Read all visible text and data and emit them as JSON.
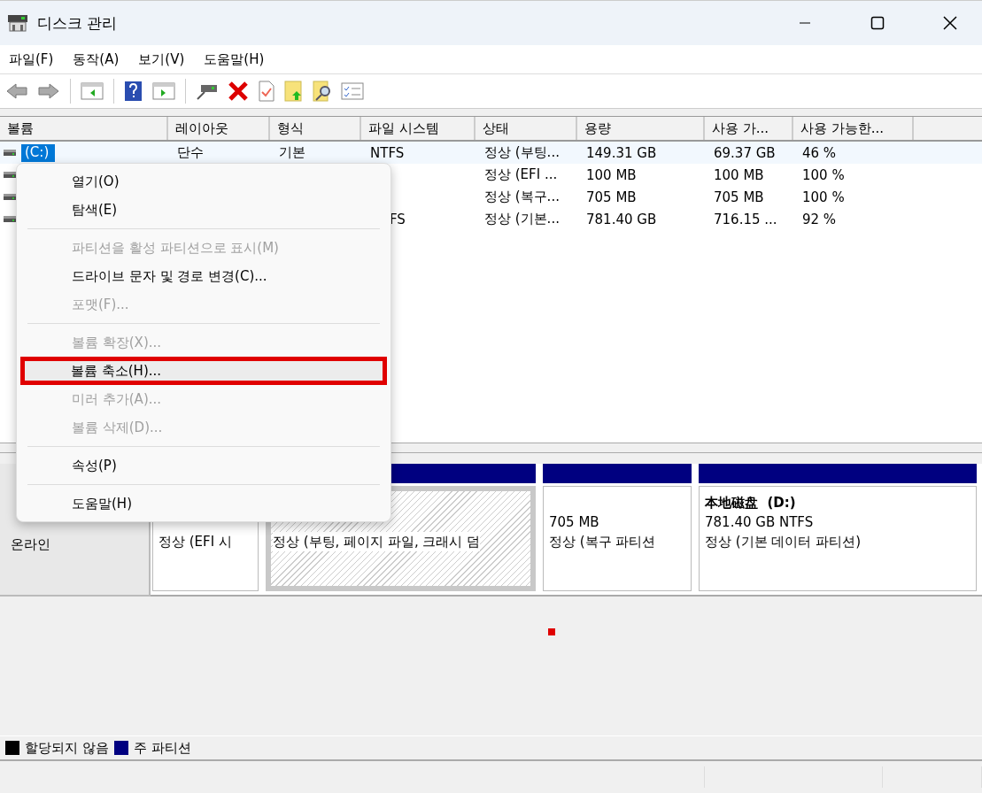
{
  "window": {
    "title": "디스크 관리"
  },
  "menu_bar": [
    "파일(F)",
    "동작(A)",
    "보기(V)",
    "도움말(H)"
  ],
  "volume_table": {
    "columns": [
      "볼륨",
      "레이아웃",
      "형식",
      "파일 시스템",
      "상태",
      "용량",
      "사용 가...",
      "사용 가능한..."
    ],
    "rows": [
      {
        "selected": true,
        "cells": [
          {
            "text": "(C:)"
          },
          {
            "text": "단수"
          },
          {
            "text": "기본"
          },
          {
            "text": "NTFS"
          },
          {
            "text": "정상 (부팅..."
          },
          {
            "text": "149.31 GB"
          },
          {
            "text": "69.37 GB"
          },
          {
            "text": "46 %"
          }
        ]
      },
      {
        "selected": false,
        "cells": [
          null,
          null,
          null,
          null,
          {
            "text": "정상 (EFI ..."
          },
          {
            "text": "100 MB"
          },
          {
            "text": "100 MB"
          },
          {
            "text": "100 %"
          }
        ]
      },
      {
        "selected": false,
        "cells": [
          null,
          null,
          null,
          null,
          {
            "text": "정상 (복구..."
          },
          {
            "text": "705 MB"
          },
          {
            "text": "705 MB"
          },
          {
            "text": "100 %"
          }
        ]
      },
      {
        "selected": false,
        "cells": [
          null,
          null,
          null,
          {
            "text": "FS",
            "cut": true
          },
          {
            "text": "정상 (기본..."
          },
          {
            "text": "781.40 GB"
          },
          {
            "text": "716.15 ..."
          },
          {
            "text": "92 %"
          }
        ]
      }
    ]
  },
  "context_menu": [
    {
      "kind": "item",
      "label": "열기(O)",
      "disabled": false,
      "highlighted": false
    },
    {
      "kind": "item",
      "label": "탐색(E)",
      "disabled": false,
      "highlighted": false
    },
    {
      "kind": "separator"
    },
    {
      "kind": "item",
      "label": "파티션을 활성 파티션으로 표시(M)",
      "disabled": true,
      "highlighted": false
    },
    {
      "kind": "item",
      "label": "드라이브 문자 및 경로 변경(C)...",
      "disabled": false,
      "highlighted": false
    },
    {
      "kind": "item",
      "label": "포맷(F)...",
      "disabled": true,
      "highlighted": false
    },
    {
      "kind": "separator"
    },
    {
      "kind": "item",
      "label": "볼륨 확장(X)...",
      "disabled": true,
      "highlighted": false
    },
    {
      "kind": "item",
      "label": "볼륨 축소(H)...",
      "disabled": false,
      "highlighted": true
    },
    {
      "kind": "item",
      "label": "미러 추가(A)...",
      "disabled": true,
      "highlighted": false
    },
    {
      "kind": "item",
      "label": "볼륨 삭제(D)...",
      "disabled": true,
      "highlighted": false
    },
    {
      "kind": "separator"
    },
    {
      "kind": "item",
      "label": "속성(P)",
      "disabled": false,
      "highlighted": false
    },
    {
      "kind": "separator"
    },
    {
      "kind": "item",
      "label": "도움말(H)",
      "disabled": false,
      "highlighted": false
    }
  ],
  "disk": {
    "status": "온라인",
    "partitions": [
      {
        "selected": false,
        "lines": [
          "정상 (EFI 시"
        ]
      },
      {
        "selected": true,
        "lines": [
          "정상 (부팅, 페이지 파일, 크래시 덤"
        ]
      },
      {
        "selected": false,
        "lines": [
          "705 MB",
          "정상 (복구 파티션"
        ]
      },
      {
        "selected": false,
        "title": "本地磁盘  (D:)",
        "lines": [
          "781.40 GB NTFS",
          "정상 (기본 데이터 파티션)"
        ]
      }
    ]
  },
  "legend": [
    {
      "label": "할당되지 않음",
      "color": "#000000"
    },
    {
      "label": "주 파티션",
      "color": "#000080"
    }
  ]
}
